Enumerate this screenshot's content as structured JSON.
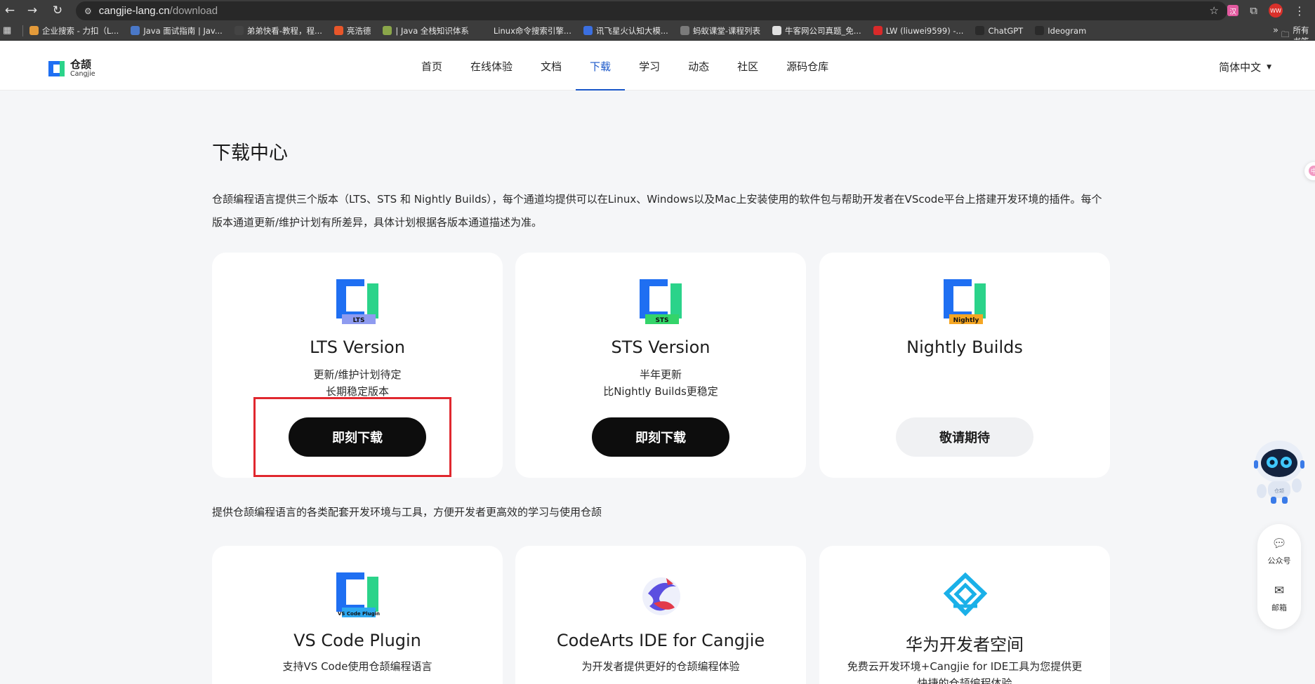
{
  "browser": {
    "url_host": "cangjie-lang.cn",
    "url_path": "/download",
    "ext_badge": "汉",
    "avatar_initials": "WW",
    "bookmarks": [
      {
        "label": "企业搜索 - 力扣（L...",
        "color": "#e39a3a"
      },
      {
        "label": "Java 面试指南 | Jav...",
        "color": "#4a78c8"
      },
      {
        "label": "弟弟快看-教程，程...",
        "color": "#444444"
      },
      {
        "label": "亮浩德",
        "color": "#e8562a"
      },
      {
        "label": "| Java 全栈知识体系",
        "color": "#8aa64a"
      },
      {
        "label": "Linux命令搜索引擎...",
        "color": "#3c3c3c"
      },
      {
        "label": "讯飞星火认知大模...",
        "color": "#3b6fe0"
      },
      {
        "label": "蚂蚁课堂-课程列表",
        "color": "#7a7a7a"
      },
      {
        "label": "牛客网公司真题_免...",
        "color": "#e0e0e0"
      },
      {
        "label": "LW (liuwei9599) -...",
        "color": "#d92a2a"
      },
      {
        "label": "ChatGPT",
        "color": "#2a2a2a"
      },
      {
        "label": "Ideogram",
        "color": "#2a2a2a"
      }
    ],
    "bookmarks_overflow": "»",
    "bookmarks_folder": "所有书签"
  },
  "header": {
    "logo_zh": "仓颉",
    "logo_en": "Cangjie",
    "nav": [
      {
        "label": "首页",
        "active": false
      },
      {
        "label": "在线体验",
        "active": false
      },
      {
        "label": "文档",
        "active": false
      },
      {
        "label": "下载",
        "active": true
      },
      {
        "label": "学习",
        "active": false
      },
      {
        "label": "动态",
        "active": false
      },
      {
        "label": "社区",
        "active": false
      },
      {
        "label": "源码仓库",
        "active": false
      }
    ],
    "language": "简体中文"
  },
  "main": {
    "title": "下载中心",
    "intro": "仓颉编程语言提供三个版本（LTS、STS 和 Nightly Builds），每个通道均提供可以在Linux、Windows以及Mac上安装使用的软件包与帮助开发者在VScode平台上搭建开发环境的插件。每个版本通道更新/维护计划有所差异，具体计划根据各版本通道描述为准。",
    "versions": [
      {
        "badge": "LTS",
        "badge_color": "#8e9bf0",
        "title": "LTS Version",
        "desc": [
          "更新/维护计划待定",
          "长期稳定版本"
        ],
        "button": "即刻下载",
        "enabled": true
      },
      {
        "badge": "STS",
        "badge_color": "#34d46a",
        "title": "STS Version",
        "desc": [
          "半年更新",
          "比Nightly Builds更稳定"
        ],
        "button": "即刻下载",
        "enabled": true
      },
      {
        "badge": "Nightly",
        "badge_color": "#f5a623",
        "title": "Nightly Builds",
        "desc": [],
        "button": "敬请期待",
        "enabled": false
      }
    ],
    "tools_intro": "提供仓颉编程语言的各类配套开发环境与工具，方便开发者更高效的学习与使用仓颉",
    "tools": [
      {
        "title": "VS Code Plugin",
        "desc": "支持VS Code使用仓颉编程语言",
        "badge": "VS Code Plugin"
      },
      {
        "title": "CodeArts IDE for Cangjie",
        "desc": "为开发者提供更好的仓颉编程体验"
      },
      {
        "title": "华为开发者空间",
        "desc": "免费云开发环境+Cangjie for IDE工具为您提供更快捷的仓颉编程体验"
      }
    ]
  },
  "widgets": {
    "robot_label": "仓颉",
    "edge_bubble": "中",
    "side": [
      {
        "label": "公众号"
      },
      {
        "label": "邮箱"
      }
    ]
  }
}
